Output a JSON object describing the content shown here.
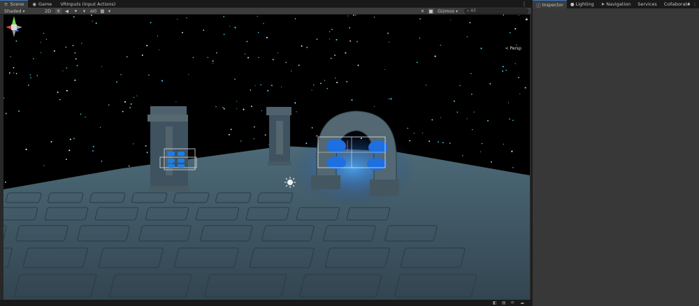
{
  "scene_tabs": [
    {
      "label": "Scene",
      "icon": "scene-icon",
      "active": true
    },
    {
      "label": "Game",
      "icon": "game-icon",
      "active": false
    },
    {
      "label": "VRInputs (Input Actions)",
      "icon": "",
      "active": false
    }
  ],
  "toolbar": {
    "shading_mode": "Shaded",
    "mode_2d": "2D",
    "layers_count": "0",
    "gizmos_label": "Gizmos",
    "search_prefix": "All",
    "search_placeholder": ""
  },
  "viewport": {
    "perspective_label": "< Persp"
  },
  "inspector_tabs": [
    {
      "label": "Inspector",
      "icon": "inspector-icon",
      "active": true
    },
    {
      "label": "Lighting",
      "icon": "lighting-icon",
      "active": false
    },
    {
      "label": "Navigation",
      "icon": "navigation-icon",
      "active": false
    },
    {
      "label": "Services",
      "icon": "",
      "active": false
    },
    {
      "label": "Collaborate",
      "icon": "",
      "active": false
    }
  ],
  "colors": {
    "accent": "#3a79bb",
    "panel": "#383838",
    "toolbar": "#3c3c3c",
    "floor": "#3d5461",
    "portal_glow": "#2a8cff"
  }
}
